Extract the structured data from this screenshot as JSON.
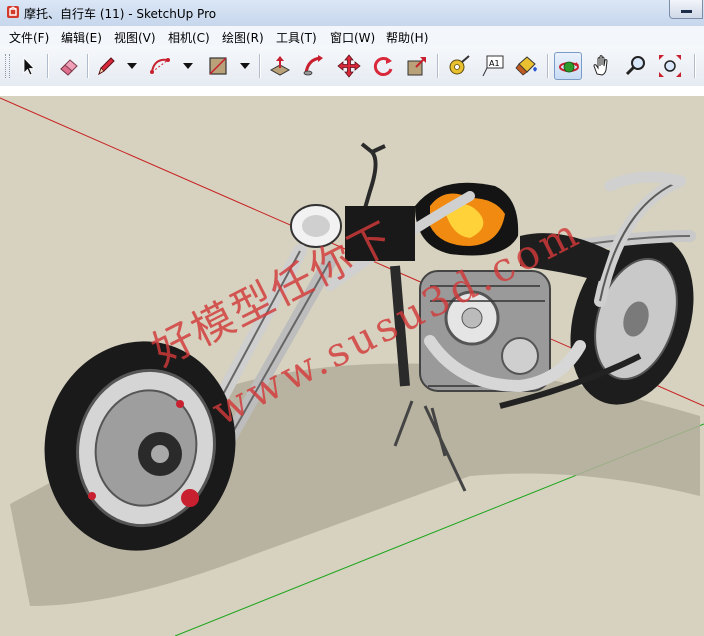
{
  "window": {
    "title": "摩托、自行车 (11) - SketchUp Pro"
  },
  "menu": {
    "items": [
      "文件(F)",
      "编辑(E)",
      "视图(V)",
      "相机(C)",
      "绘图(R)",
      "工具(T)",
      "窗口(W)",
      "帮助(H)"
    ]
  },
  "toolbar": {
    "tools": [
      {
        "icon": "select-arrow-icon"
      },
      {
        "icon": "eraser-icon"
      },
      {
        "icon": "pencil-line-icon"
      },
      {
        "icon": "arc-icon"
      },
      {
        "icon": "rectangle-icon"
      },
      {
        "icon": "push-pull-icon"
      },
      {
        "icon": "follow-me-icon"
      },
      {
        "icon": "move-icon"
      },
      {
        "icon": "rotate-icon"
      },
      {
        "icon": "scale-icon"
      },
      {
        "icon": "tape-measure-icon"
      },
      {
        "icon": "text-icon",
        "label": "A1"
      },
      {
        "icon": "paint-bucket-icon"
      },
      {
        "icon": "orbit-icon",
        "active": true
      },
      {
        "icon": "pan-icon"
      },
      {
        "icon": "zoom-icon"
      },
      {
        "icon": "zoom-extents-icon"
      }
    ]
  },
  "watermark": {
    "line1": "好模型任你下",
    "line2": "www.susu3d.com"
  },
  "colors": {
    "ground": "#d6d2bf",
    "sky": "#ffffff",
    "red_axis": "#c81e1e",
    "green_axis": "#1ea51e",
    "watermark": "#d33a3a"
  }
}
